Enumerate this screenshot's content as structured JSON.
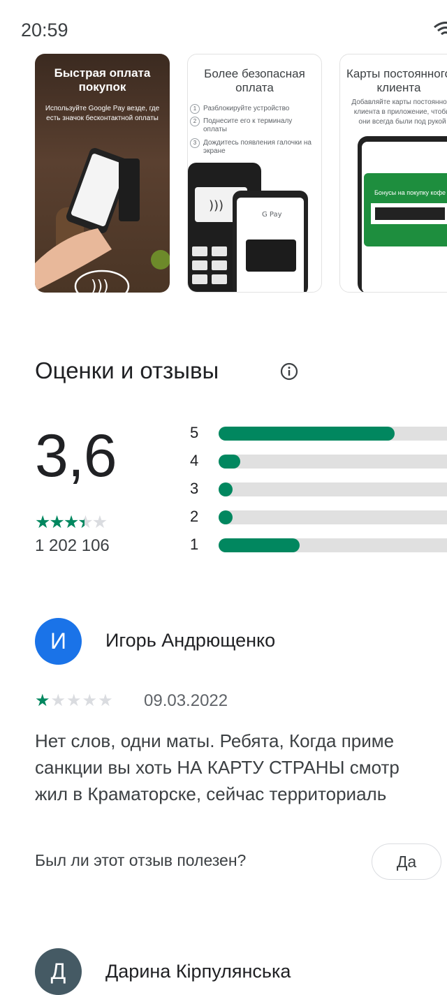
{
  "status_bar": {
    "time": "20:59"
  },
  "screenshots": [
    {
      "title": "Быстрая оплата покупок",
      "subtitle": "Используйте Google Pay везде, где есть значок бесконтактной оплаты"
    },
    {
      "title": "Более безопасная оплата",
      "steps": [
        "Разблокируйте устройство",
        "Поднесите его к терминалу оплаты",
        "Дождитесь появления галочки на экране"
      ]
    },
    {
      "title": "Карты постоянного клиента",
      "subtitle": "Добавляйте карты постоянного клиента в приложение, чтобы они всегда были под рукой",
      "card_label": "Бонусы на покупку кофе"
    }
  ],
  "ratings": {
    "section_title": "Оценки и отзывы",
    "average": "3,6",
    "stars_value": 3.5,
    "count": "1 202 106",
    "distribution": [
      {
        "label": "5",
        "fraction": 0.74
      },
      {
        "label": "4",
        "fraction": 0.09
      },
      {
        "label": "3",
        "fraction": 0.06
      },
      {
        "label": "2",
        "fraction": 0.06
      },
      {
        "label": "1",
        "fraction": 0.34
      }
    ]
  },
  "reviews": [
    {
      "avatar_letter": "И",
      "avatar_color": "#1a73e8",
      "name": "Игорь Андрющенко",
      "stars": 1,
      "date": "09.03.2022",
      "text_lines": [
        "Нет слов, одни маты. Ребята, Когда приме",
        "санкции вы хоть НА КАРТУ СТРАНЫ смотр",
        "жил в Краматорске, сейчас территориаль"
      ],
      "helpful_question": "Был ли этот отзыв полезен?",
      "helpful_yes": "Да"
    },
    {
      "avatar_letter": "Д",
      "avatar_color": "#455a64",
      "name": "Дарина Кірпулянська"
    }
  ],
  "colors": {
    "accent": "#01875f"
  }
}
